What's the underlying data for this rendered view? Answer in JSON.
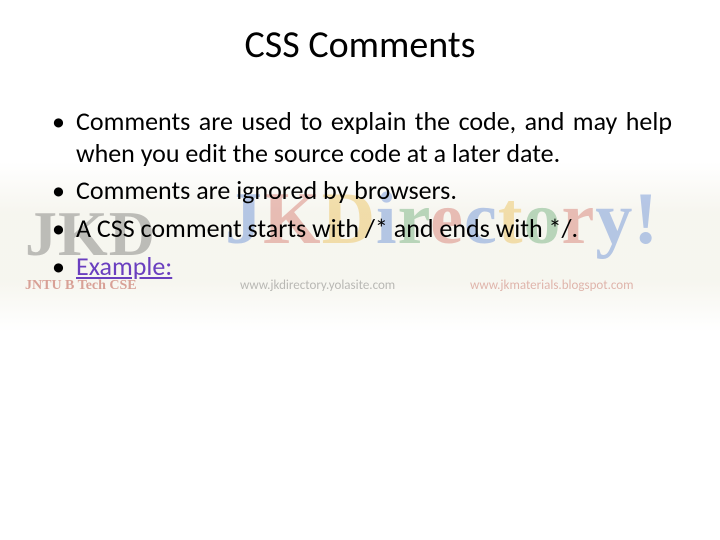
{
  "title": "CSS Comments",
  "bullets": [
    "Comments are used to explain the code, and may help when you edit the source code at a later date.",
    "Comments are ignored by browsers.",
    "A CSS comment starts with /* and ends with */.",
    "Example:"
  ],
  "watermark": {
    "logo_left": "JKD",
    "brand": "JKDirectory!",
    "sub_left": "JNTU B Tech CSE",
    "sub_mid": "www.jkdirectory.yolasite.com",
    "sub_right": "www.jkmaterials.blogspot.com"
  }
}
